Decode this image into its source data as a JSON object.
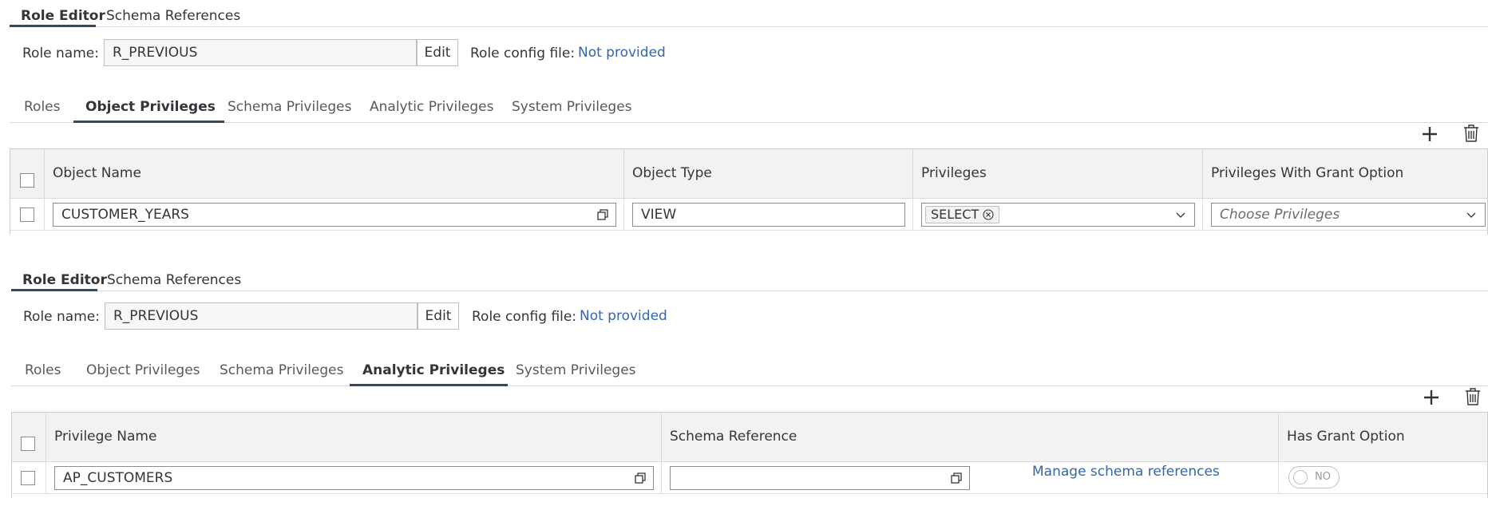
{
  "panel1": {
    "top_tabs": [
      "Role Editor",
      "Schema References"
    ],
    "role_name_label": "Role name:",
    "role_name_value": "R_PREVIOUS",
    "edit_label": "Edit",
    "config_label": "Role config file:",
    "config_link": "Not provided",
    "sub_tabs": [
      "Roles",
      "Object Privileges",
      "Schema Privileges",
      "Analytic Privileges",
      "System Privileges"
    ],
    "active_sub_tab": "Object Privileges",
    "columns": [
      "Object Name",
      "Object Type",
      "Privileges",
      "Privileges With Grant Option"
    ],
    "rows": [
      {
        "object_name": "CUSTOMER_YEARS",
        "object_type": "VIEW",
        "privilege_token": "SELECT",
        "grant_placeholder": "Choose Privileges"
      }
    ]
  },
  "panel2": {
    "top_tabs": [
      "Role Editor",
      "Schema References"
    ],
    "role_name_label": "Role name:",
    "role_name_value": "R_PREVIOUS",
    "edit_label": "Edit",
    "config_label": "Role config file:",
    "config_link": "Not provided",
    "sub_tabs": [
      "Roles",
      "Object Privileges",
      "Schema Privileges",
      "Analytic Privileges",
      "System Privileges"
    ],
    "active_sub_tab": "Analytic Privileges",
    "columns": [
      "Privilege Name",
      "Schema Reference",
      "Has Grant Option"
    ],
    "rows": [
      {
        "privilege_name": "AP_CUSTOMERS",
        "schema_reference": "",
        "manage_link": "Manage schema references",
        "grant_switch": "NO"
      }
    ]
  },
  "icons": {
    "add": "plus-icon",
    "delete": "trash-icon",
    "value_help": "value-help-icon",
    "dropdown": "chevron-down-icon",
    "token_remove": "circle-x-icon"
  },
  "colors": {
    "accent": "#354a5f",
    "link": "#3366aa",
    "header_bg": "#f2f2f2"
  }
}
